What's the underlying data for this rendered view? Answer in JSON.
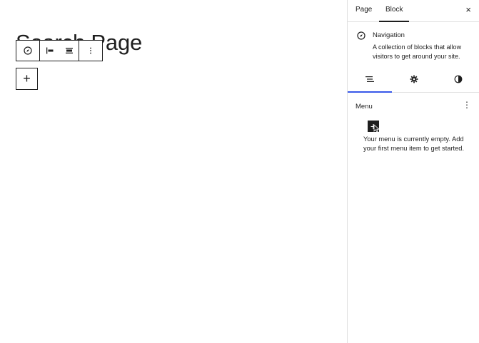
{
  "editor": {
    "page_title": "Search Page",
    "block_toolbar": {
      "block_icon": "compass-icon",
      "justify_left_icon": "justify-left-icon",
      "justify_center_icon": "justify-center-icon",
      "options_icon": "more-vertical-icon"
    },
    "add_block_label": "+"
  },
  "sidebar": {
    "tabs": [
      {
        "label": "Page"
      },
      {
        "label": "Block"
      }
    ],
    "close_label": "×",
    "block_card": {
      "title": "Navigation",
      "description": "A collection of blocks that allow visitors to get around your site."
    },
    "sub_tabs": [
      "list-view-icon",
      "gear-icon",
      "contrast-icon"
    ],
    "menu": {
      "label": "Menu",
      "options_label": "⋮",
      "add_item_label": "+",
      "empty_message": "Your menu is currently empty. Add your first menu item to get started."
    },
    "accent_color": "#3858e9"
  }
}
